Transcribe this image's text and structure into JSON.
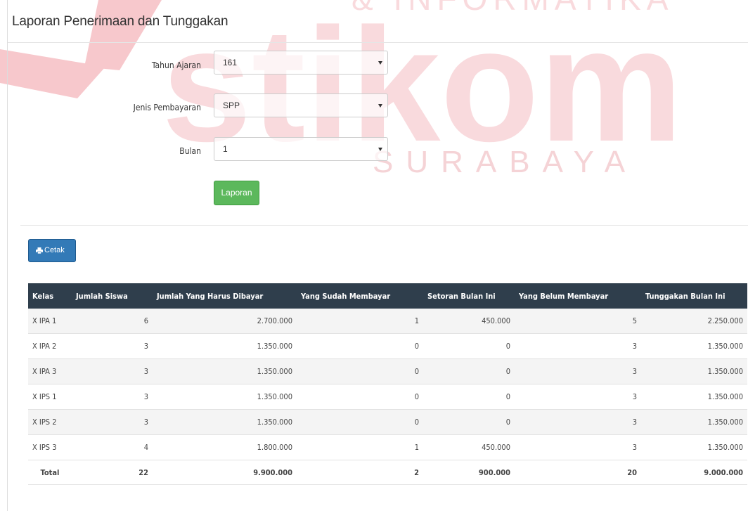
{
  "page": {
    "title": "Laporan Penerimaan dan Tunggakan"
  },
  "form": {
    "tahun_ajaran": {
      "label": "Tahun Ajaran",
      "value": "161"
    },
    "jenis_pembayaran": {
      "label": "Jenis Pembayaran",
      "value": "SPP"
    },
    "bulan": {
      "label": "Bulan",
      "value": "1"
    },
    "submit_label": "Laporan"
  },
  "actions": {
    "print_label": "Cetak"
  },
  "watermark": {
    "logo_text": "stikom",
    "top_text": "& INFORMATIKA",
    "sub_text": "SURABAYA",
    "color": "#f9dadd"
  },
  "colors": {
    "table_header": "#2f3e4c",
    "success": "#5cb85c",
    "primary": "#337ab7"
  },
  "table": {
    "headers": [
      "Kelas",
      "Jumlah Siswa",
      "Jumlah Yang Harus Dibayar",
      "Yang Sudah Membayar",
      "Setoran Bulan Ini",
      "Yang Belum Membayar",
      "Tunggakan Bulan Ini"
    ],
    "rows": [
      [
        "X IPA 1",
        "6",
        "2.700.000",
        "1",
        "450.000",
        "5",
        "2.250.000"
      ],
      [
        "X IPA 2",
        "3",
        "1.350.000",
        "0",
        "0",
        "3",
        "1.350.000"
      ],
      [
        "X IPA 3",
        "3",
        "1.350.000",
        "0",
        "0",
        "3",
        "1.350.000"
      ],
      [
        "X IPS 1",
        "3",
        "1.350.000",
        "0",
        "0",
        "3",
        "1.350.000"
      ],
      [
        "X IPS 2",
        "3",
        "1.350.000",
        "0",
        "0",
        "3",
        "1.350.000"
      ],
      [
        "X IPS 3",
        "4",
        "1.800.000",
        "1",
        "450.000",
        "3",
        "1.350.000"
      ]
    ],
    "total": [
      "Total",
      "22",
      "9.900.000",
      "2",
      "900.000",
      "20",
      "9.000.000"
    ]
  }
}
